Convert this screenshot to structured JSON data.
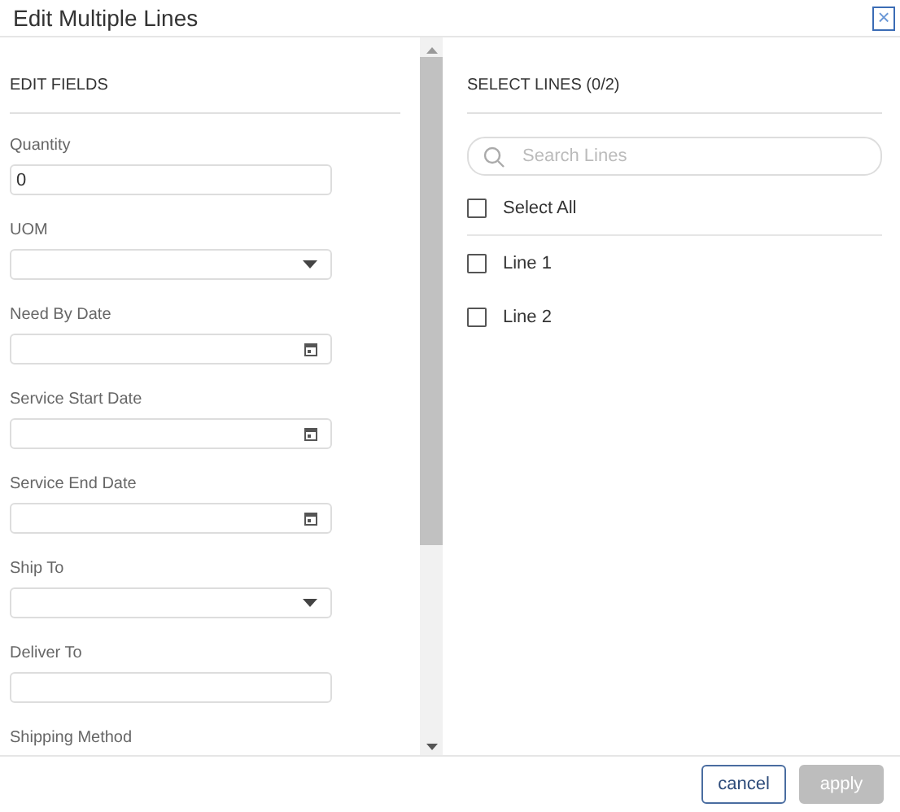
{
  "dialog": {
    "title": "Edit Multiple Lines",
    "close_label": "×"
  },
  "edit_fields": {
    "heading": "EDIT FIELDS",
    "fields": [
      {
        "label": "Quantity",
        "kind": "text",
        "value": "0"
      },
      {
        "label": "UOM",
        "kind": "select"
      },
      {
        "label": "Need By Date",
        "kind": "date"
      },
      {
        "label": "Service Start Date",
        "kind": "date"
      },
      {
        "label": "Service End Date",
        "kind": "date"
      },
      {
        "label": "Ship To",
        "kind": "select"
      },
      {
        "label": "Deliver To",
        "kind": "text"
      },
      {
        "label": "Shipping Method",
        "kind": "label_only"
      }
    ]
  },
  "select_lines": {
    "heading": "SELECT LINES (0/2)",
    "search": {
      "placeholder": "Search Lines"
    },
    "select_all": {
      "label": "Select All",
      "checked": false
    },
    "lines": [
      {
        "label": "Line 1",
        "checked": false
      },
      {
        "label": "Line 2",
        "checked": false
      }
    ]
  },
  "buttons": [
    {
      "label": "cancel",
      "disabled": false
    },
    {
      "label": "apply",
      "disabled": true
    }
  ]
}
